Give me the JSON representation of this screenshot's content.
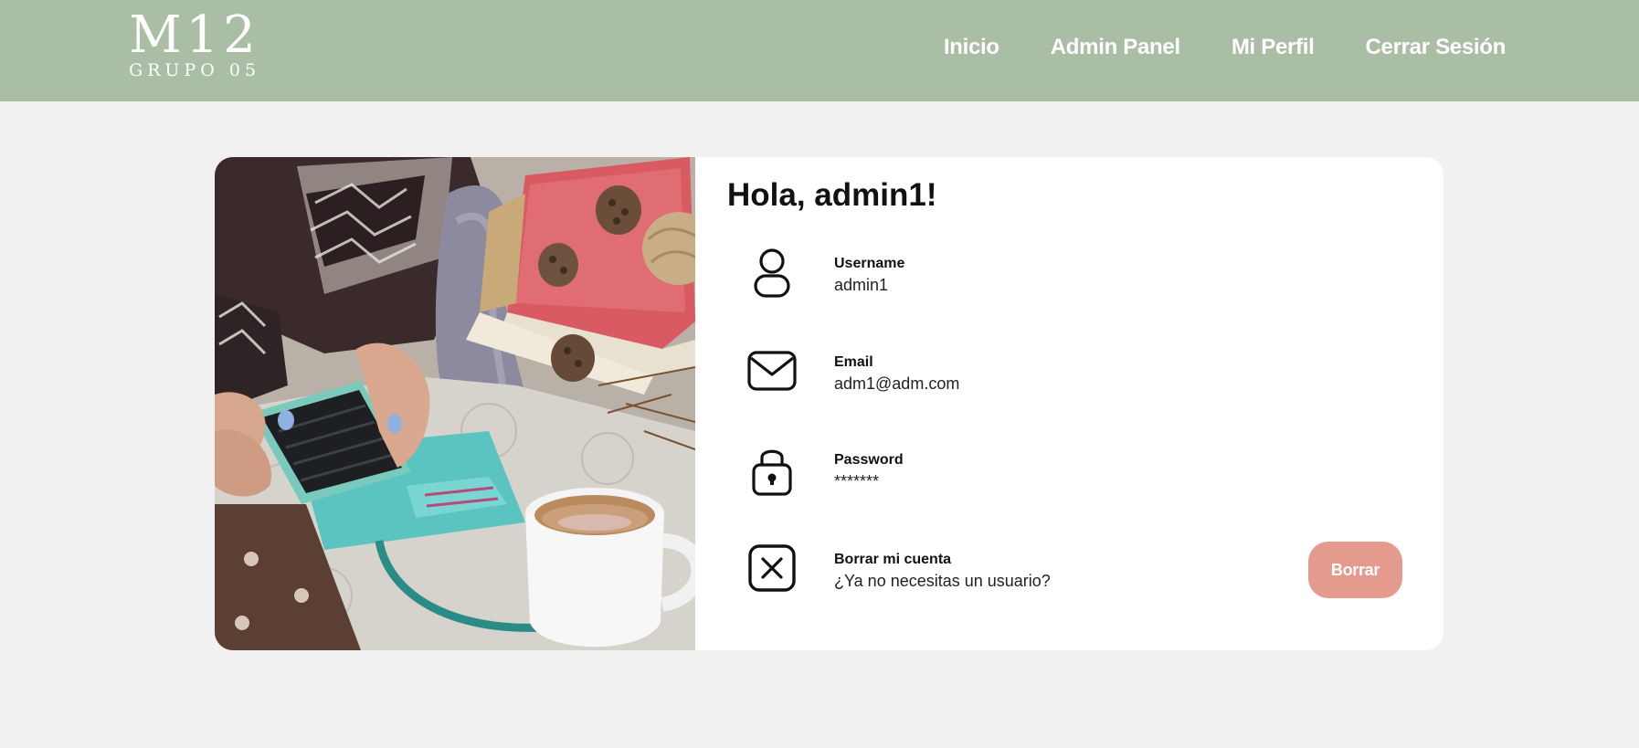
{
  "header": {
    "logo_main": "M12",
    "logo_sub": "GRUPO 05",
    "nav": [
      {
        "label": "Inicio"
      },
      {
        "label": "Admin Panel"
      },
      {
        "label": "Mi Perfil"
      },
      {
        "label": "Cerrar Sesión"
      }
    ]
  },
  "profile": {
    "greeting": "Hola, admin1!",
    "fields": [
      {
        "label": "Username",
        "value": "admin1",
        "icon": "user-icon"
      },
      {
        "label": "Email",
        "value": "adm1@adm.com",
        "icon": "mail-icon"
      },
      {
        "label": "Password",
        "value": "*******",
        "icon": "lock-icon"
      },
      {
        "label": "Borrar mi cuenta",
        "value": "¿Ya no necesitas un usuario?",
        "icon": "close-box-icon"
      }
    ],
    "delete_label": "Borrar"
  },
  "colors": {
    "header_bg": "#aabea5",
    "page_bg": "#f1f1f1",
    "card_bg": "#ffffff",
    "delete_button": "#e59a8e"
  }
}
